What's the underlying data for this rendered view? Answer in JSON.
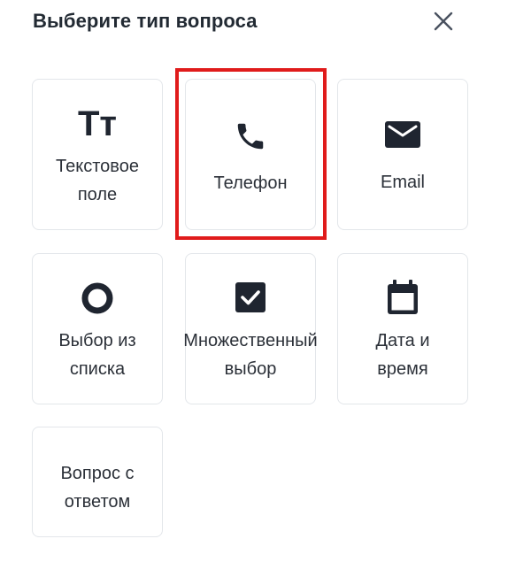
{
  "dialog": {
    "title": "Выберите тип вопроса",
    "close_icon": "close-icon"
  },
  "question_types": [
    {
      "label": "Текстовое\nполе",
      "icon": "text-icon",
      "icon_text": "Tт"
    },
    {
      "label": "Телефон",
      "icon": "phone-icon",
      "highlighted": true
    },
    {
      "label": "Email",
      "icon": "mail-icon"
    },
    {
      "label": "Выбор из\nсписка",
      "icon": "radio-icon"
    },
    {
      "label": "Множественный\nвыбор",
      "icon": "checkbox-icon"
    },
    {
      "label": "Дата и\nвремя",
      "icon": "calendar-icon"
    },
    {
      "label": "Вопрос с\nответом",
      "icon": ""
    }
  ],
  "colors": {
    "highlight": "#e01b1b",
    "icon": "#1f2530",
    "card_border": "#e3e6ea"
  }
}
